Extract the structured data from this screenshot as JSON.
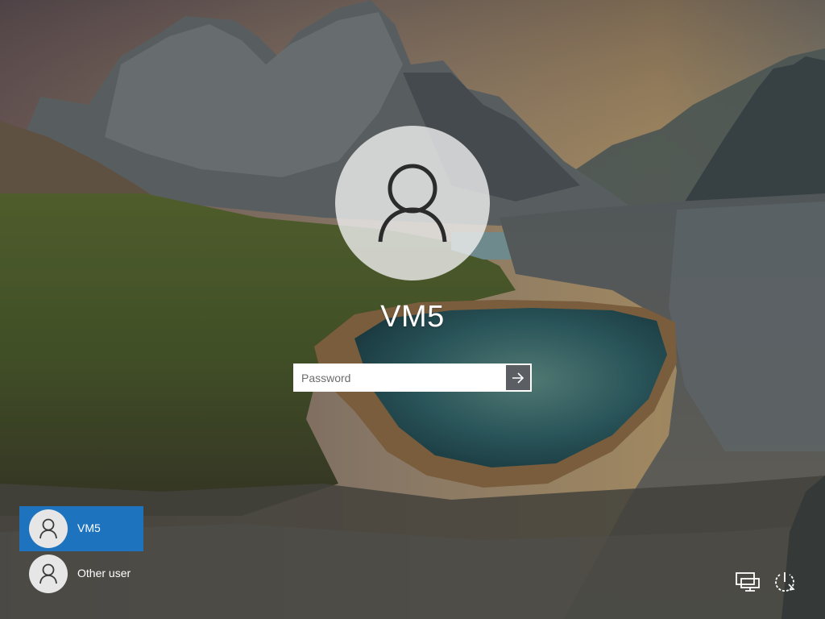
{
  "login": {
    "user_name": "VM5",
    "password_placeholder": "Password",
    "submit_icon": "arrow-right-icon",
    "avatar_icon": "user-icon"
  },
  "user_switcher": {
    "users": [
      {
        "label": "VM5",
        "selected": true,
        "icon": "user-icon"
      },
      {
        "label": "Other user",
        "selected": false,
        "icon": "user-icon"
      }
    ]
  },
  "system_tray": {
    "icons": [
      "network-icon",
      "power-icon"
    ]
  },
  "colors": {
    "selected_tile": "#1e73be",
    "submit_button": "#5b5e63",
    "text": "#ffffff"
  }
}
